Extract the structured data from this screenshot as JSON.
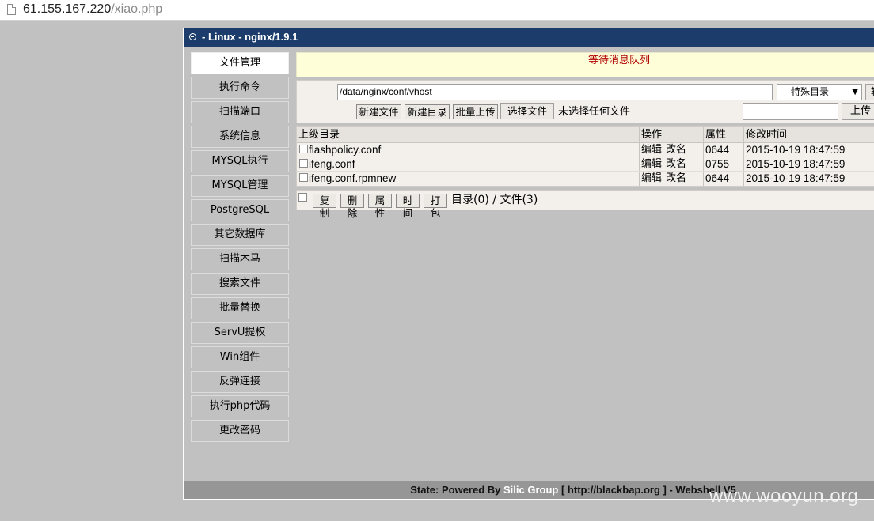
{
  "browser": {
    "url_host": "61.155.167.220",
    "url_path": "/xiao.php"
  },
  "window": {
    "title": "- Linux - nginx/1.9.1"
  },
  "sidebar": {
    "items": [
      {
        "label": "文件管理",
        "active": true
      },
      {
        "label": "执行命令"
      },
      {
        "label": "扫描端口"
      },
      {
        "label": "系统信息"
      },
      {
        "label": "MYSQL执行"
      },
      {
        "label": "MYSQL管理"
      },
      {
        "label": "PostgreSQL"
      },
      {
        "label": "其它数据库"
      },
      {
        "label": "扫描木马"
      },
      {
        "label": "搜索文件"
      },
      {
        "label": "批量替换"
      },
      {
        "label": "ServU提权"
      },
      {
        "label": "Win组件"
      },
      {
        "label": "反弹连接"
      },
      {
        "label": "执行php代码"
      },
      {
        "label": "更改密码"
      }
    ]
  },
  "message_bar": {
    "text": "等待消息队列"
  },
  "path_panel": {
    "path_value": "/data/nginx/conf/vhost",
    "dir_select": "---特殊目录---",
    "go_label": "转",
    "new_file": "新建文件",
    "new_dir": "新建目录",
    "batch_upload": "批量上传",
    "choose_file": "选择文件",
    "no_file": "未选择任何文件",
    "upload": "上传"
  },
  "file_table": {
    "headers": [
      "上级目录",
      "操作",
      "属性",
      "修改时间"
    ],
    "rows": [
      {
        "name": "flashpolicy.conf",
        "edit": "编辑",
        "rename": "改名",
        "perm": "0644",
        "mtime": "2015-10-19 18:47:59"
      },
      {
        "name": "ifeng.conf",
        "edit": "编辑",
        "rename": "改名",
        "perm": "0755",
        "mtime": "2015-10-19 18:47:59"
      },
      {
        "name": "ifeng.conf.rpmnew",
        "edit": "编辑",
        "rename": "改名",
        "perm": "0644",
        "mtime": "2015-10-19 18:47:59"
      }
    ]
  },
  "bottom_bar": {
    "copy": "复制",
    "delete": "删除",
    "attr": "属性",
    "time": "时间",
    "pack": "打包",
    "count": "目录(0) / 文件(3)"
  },
  "footer": {
    "prefix": "State: Powered By",
    "brand": "Silic Group",
    "suffix": "[ http://blackbap.org ] - Webshell V5"
  },
  "watermark": "www.wooyun.org"
}
